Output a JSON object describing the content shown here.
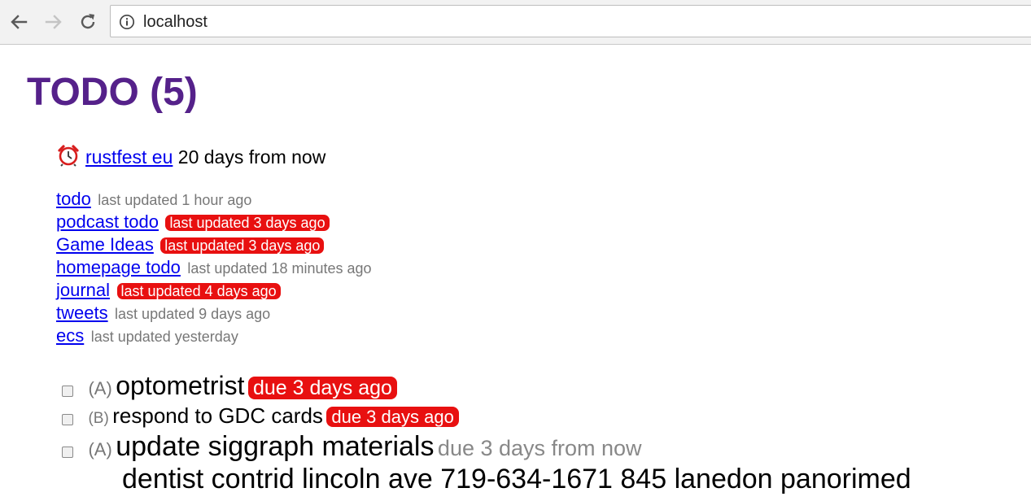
{
  "browser": {
    "url": "localhost",
    "back_icon": "arrow-left-icon",
    "forward_icon": "arrow-right-icon",
    "reload_icon": "reload-icon",
    "info_icon": "info-circle-icon"
  },
  "page": {
    "title": "TODO (5)",
    "title_color": "#55218a",
    "event": {
      "icon": "alarm-clock-icon",
      "name": "rustfest eu",
      "when": "20 days from now"
    },
    "lists": [
      {
        "name": "todo",
        "updated": "last updated 1 hour ago",
        "stale": false
      },
      {
        "name": "podcast todo",
        "updated": "last updated 3 days ago",
        "stale": true
      },
      {
        "name": "Game Ideas",
        "updated": "last updated 3 days ago",
        "stale": true
      },
      {
        "name": "homepage todo",
        "updated": "last updated 18 minutes ago",
        "stale": false
      },
      {
        "name": "journal",
        "updated": "last updated 4 days ago",
        "stale": true
      },
      {
        "name": "tweets",
        "updated": "last updated 9 days ago",
        "stale": false
      },
      {
        "name": "ecs",
        "updated": "last updated yesterday",
        "stale": false
      }
    ],
    "tasks": [
      {
        "priority": "(A)",
        "title": "optometrist",
        "due": "due 3 days ago",
        "overdue": true
      },
      {
        "priority": "(B)",
        "title": "respond to GDC cards",
        "due": "due 3 days ago",
        "overdue": true
      },
      {
        "priority": "(A)",
        "title": "update siggraph materials",
        "due": "due 3 days from now",
        "overdue": false
      },
      {
        "priority": "",
        "title": "dentist contrid lincoln ave 719-634-1671 845 lanedon panorimed",
        "due": "",
        "overdue": false
      }
    ],
    "colors": {
      "link": "#0000ee",
      "overdue_bg": "#e81010",
      "muted": "#777777"
    }
  }
}
